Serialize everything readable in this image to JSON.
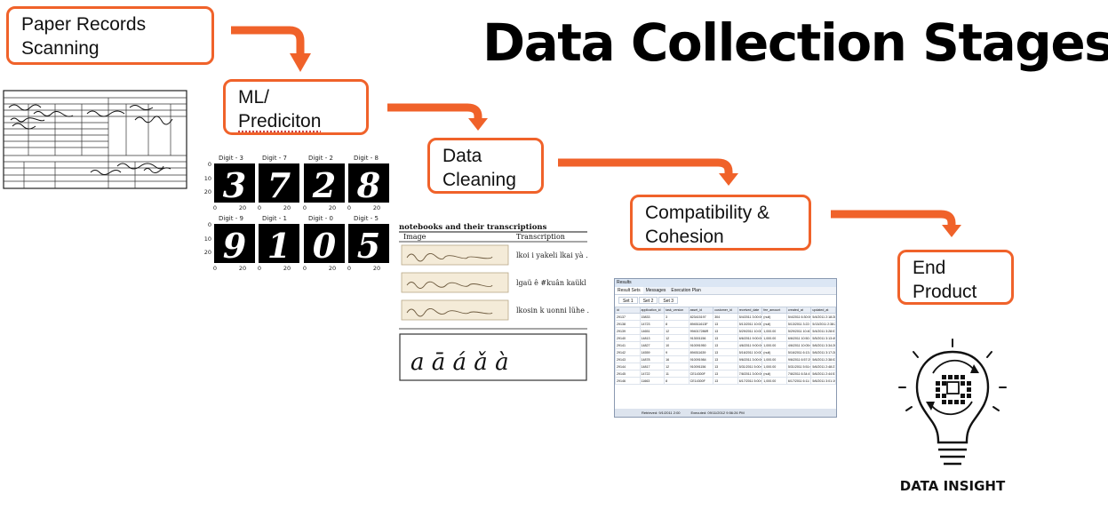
{
  "title": "Data Collection Stages",
  "accent_color": "#f0622a",
  "stages": [
    {
      "line1": "Paper Records",
      "line2": "Scanning"
    },
    {
      "line1": "ML/",
      "line2": "Prediciton"
    },
    {
      "line1": "Data",
      "line2": "Cleaning"
    },
    {
      "line1": "Compatibility &",
      "line2": "Cohesion"
    },
    {
      "line1": "End",
      "line2": "Product"
    }
  ],
  "mnist": {
    "titles": [
      "Digit - 3",
      "Digit - 7",
      "Digit - 2",
      "Digit - 8",
      "Digit - 9",
      "Digit - 1",
      "Digit - 0",
      "Digit - 5"
    ],
    "digits": [
      "3",
      "7",
      "2",
      "8",
      "9",
      "1",
      "0",
      "5"
    ],
    "y_ticks": [
      "0",
      "10",
      "20"
    ],
    "x_ticks": [
      "0",
      "20"
    ]
  },
  "transcriptions": {
    "heading": "notebooks and their transcriptions",
    "col_image": "Image",
    "col_transcription": "Transcription",
    "rows": [
      "lkoi i yakeli lkai yà .",
      "lgaü ê #kuân kaükl",
      "lkosin k uonni lühe ."
    ],
    "script_sample": "a  ā  á  ǎ  à"
  },
  "results_window": {
    "title": "Results",
    "tabs": [
      "Result Sets",
      "Messages",
      "Execution Plan"
    ],
    "subtabs": [
      "Set 1",
      "Set 2",
      "Set 3"
    ],
    "columns": [
      "id",
      "application_id",
      "task_version",
      "asset_id",
      "customer_id",
      "received_date",
      "fee_amount",
      "created_at",
      "updated_at"
    ],
    "rows": [
      [
        "29137",
        "15833",
        "3",
        "823415197",
        "304",
        "5/4/2011 3:00:00 AM",
        "(null)",
        "5/4/2011 6:30:00 PM",
        "5/4/2011 2:18:28 PM"
      ],
      [
        "29138",
        "14723",
        "8",
        "894511613F",
        "13",
        "5/13/2011 10:00:00 AM",
        "(null)",
        "5/13/2011 3:22:17 PM",
        "5/13/2011 2:38:21 PM"
      ],
      [
        "29139",
        "14651",
        "12",
        "994017286R",
        "13",
        "5/29/2011 10:00:00 AM",
        "1,000.00",
        "5/29/2011 10:40:18 PM",
        "5/4/2011 3:28:07 PM"
      ],
      [
        "29140",
        "14813",
        "12",
        "913001156",
        "13",
        "6/6/2011 9:00:00 AM",
        "1,000.00",
        "6/6/2011 10:50:16 PM",
        "5/5/2011 3:13:49 PM"
      ],
      [
        "29141",
        "14827",
        "10",
        "910091950",
        "13",
        "4/6/2011 9:00:00 AM",
        "1,000.00",
        "4/6/2011 10:05:04 PM",
        "5/6/2011 3:34:26 PM"
      ],
      [
        "29142",
        "14559",
        "9",
        "894511639",
        "13",
        "5/16/2011 10:00:00 AM",
        "(null)",
        "5/16/2011 6:13:34 PM",
        "5/6/2011 3:17:28 PM"
      ],
      [
        "29143",
        "14878",
        "16",
        "910091984",
        "13",
        "9/6/2011 3:00:00 AM",
        "1,000.00",
        "9/6/2011 6:57:29 PM",
        "5/6/2011 2:38:03 PM"
      ],
      [
        "29144",
        "14817",
        "12",
        "910091156",
        "13",
        "5/31/2011 5:00:00 AM",
        "1,000.00",
        "5/31/2011 5:51:09 PM",
        "5/6/2011 2:48:21 PM"
      ],
      [
        "29145",
        "14722",
        "11",
        "CE14300F",
        "13",
        "7/8/2011 3:00:00 AM",
        "(null)",
        "7/8/2011 6:34:47 PM",
        "5/6/2011 2:44:51 PM"
      ],
      [
        "29146",
        "11663",
        "8",
        "CE14300F",
        "13",
        "6/17/2011 5:00:00 AM",
        "1,000.00",
        "6/17/2011 6:11:16 AM",
        "5/6/2011 3:01:19 PM"
      ]
    ],
    "status_left": "Retrieved: 9/1/2011 2:00",
    "status_right": "Executed: 09/11/2012 9:56:26 PM"
  },
  "logo_text": "DATA INSIGHT"
}
